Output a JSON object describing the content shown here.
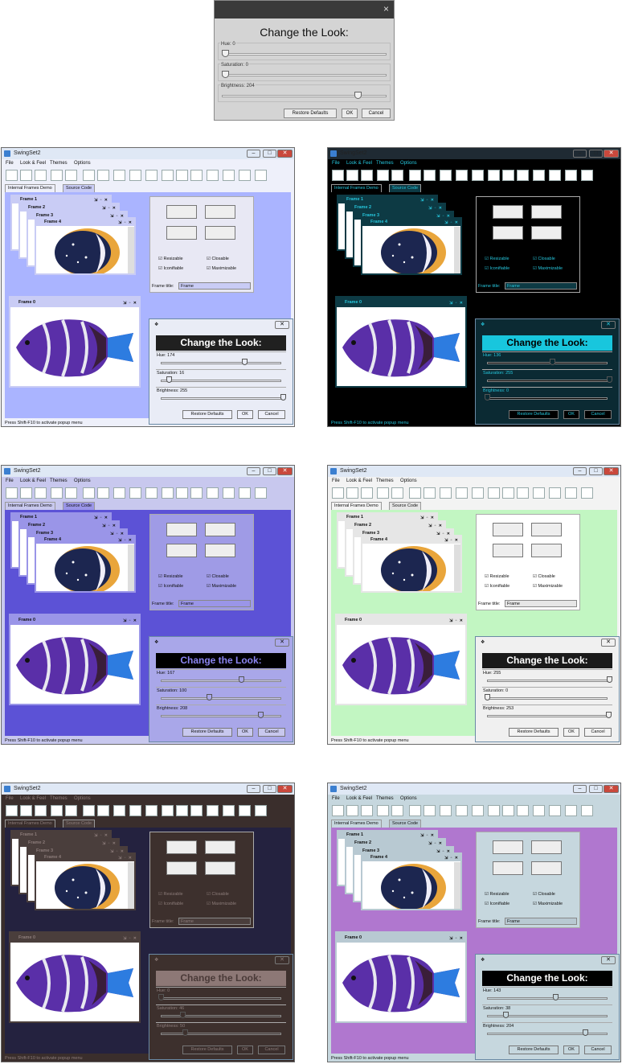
{
  "top_dialog": {
    "title": "Change the Look:",
    "close_glyph": "×",
    "sliders": [
      {
        "label": "Hue: 0",
        "value": 0
      },
      {
        "label": "Saturation: 0",
        "value": 0
      },
      {
        "label": "Brightness: 204",
        "value": 204
      }
    ],
    "buttons": {
      "restore": "Restore Defaults",
      "ok": "OK",
      "cancel": "Cancel"
    }
  },
  "app": {
    "title": "SwingSet2",
    "menus": [
      "File",
      "Look & Feel",
      "Themes",
      "Options"
    ],
    "tabs": [
      "Internal Frames Demo",
      "Source Code"
    ],
    "status": "Press Shift-F10 to activate popup menu",
    "frames": [
      "Frame 1",
      "Frame 2",
      "Frame 3",
      "Frame 4",
      "Frame 0"
    ],
    "checkboxes": [
      "Resizable",
      "Closable",
      "Iconifiable",
      "Maximizable"
    ],
    "frame_title_label": "Frame title:",
    "frame_title_value": "Frame",
    "dialog_title": "Change the Look:",
    "buttons": {
      "restore": "Restore Defaults",
      "ok": "OK",
      "cancel": "Cancel"
    },
    "window_controls": {
      "minimize": "–",
      "maximize": "□",
      "close": "✕"
    }
  },
  "panels": [
    {
      "desk": "#aab4ff",
      "chrome": "#eef0fa",
      "title_bar": "#dfe8f5",
      "frame_bar": "#c9ccf5",
      "ctrl_bg": "#e8e8f4",
      "dlg_bg": "#e9ecf6",
      "banner_bg": "#202020",
      "banner_fg": "#ffffff",
      "text": "#111111",
      "hue": "Hue: 174",
      "hue_v": 174,
      "sat": "Saturation: 16",
      "sat_v": 16,
      "bri": "Brightness: 255",
      "bri_v": 255
    },
    {
      "desk": "#000000",
      "chrome": "#000000",
      "title_bar": "#1f2a33",
      "frame_bar": "#0d3a44",
      "ctrl_bg": "#000000",
      "dlg_bg": "#0b2a33",
      "banner_bg": "#18c6dd",
      "banner_fg": "#000000",
      "text": "#26c6dc",
      "hue": "Hue: 136",
      "hue_v": 136,
      "sat": "Saturation: 255",
      "sat_v": 255,
      "bri": "Brightness: 0",
      "bri_v": 0
    },
    {
      "desk": "#5c52d6",
      "chrome": "#c8c8ee",
      "title_bar": "#dfe8f5",
      "frame_bar": "#9a95e8",
      "ctrl_bg": "#9f9be6",
      "dlg_bg": "#a9a7e9",
      "banner_bg": "#000000",
      "banner_fg": "#8a84f0",
      "text": "#111111",
      "hue": "Hue: 167",
      "hue_v": 167,
      "sat": "Saturation: 100",
      "sat_v": 100,
      "bri": "Brightness: 208",
      "bri_v": 208
    },
    {
      "desk": "#c2f6c2",
      "chrome": "#f3f3f3",
      "title_bar": "#dfe8f5",
      "frame_bar": "#e6e6e6",
      "ctrl_bg": "#ffffff",
      "dlg_bg": "#f0f0f0",
      "banner_bg": "#1a1a1a",
      "banner_fg": "#ffffff",
      "text": "#111111",
      "hue": "Hue: 255",
      "hue_v": 255,
      "sat": "Saturation: 0",
      "sat_v": 0,
      "bri": "Brightness: 253",
      "bri_v": 253
    },
    {
      "desk": "#24223f",
      "chrome": "#3a2e2c",
      "title_bar": "#dfe8f5",
      "frame_bar": "#4a3e3c",
      "ctrl_bg": "#3d302d",
      "dlg_bg": "#3d302d",
      "banner_bg": "#8d7876",
      "banner_fg": "#4a3a38",
      "text": "#8c7c7a",
      "hue": "Hue: 0",
      "hue_v": 0,
      "sat": "Saturation: 46",
      "sat_v": 46,
      "bri": "Brightness: 50",
      "bri_v": 50
    },
    {
      "desk": "#b077cf",
      "chrome": "#c6d7de",
      "title_bar": "#dfe8f5",
      "frame_bar": "#b8c9d2",
      "ctrl_bg": "#c6d7de",
      "dlg_bg": "#c6d7de",
      "banner_bg": "#000000",
      "banner_fg": "#ffffff",
      "text": "#111111",
      "hue": "Hue: 143",
      "hue_v": 143,
      "sat": "Saturation: 38",
      "sat_v": 38,
      "bri": "Brightness: 204",
      "bri_v": 204
    }
  ]
}
